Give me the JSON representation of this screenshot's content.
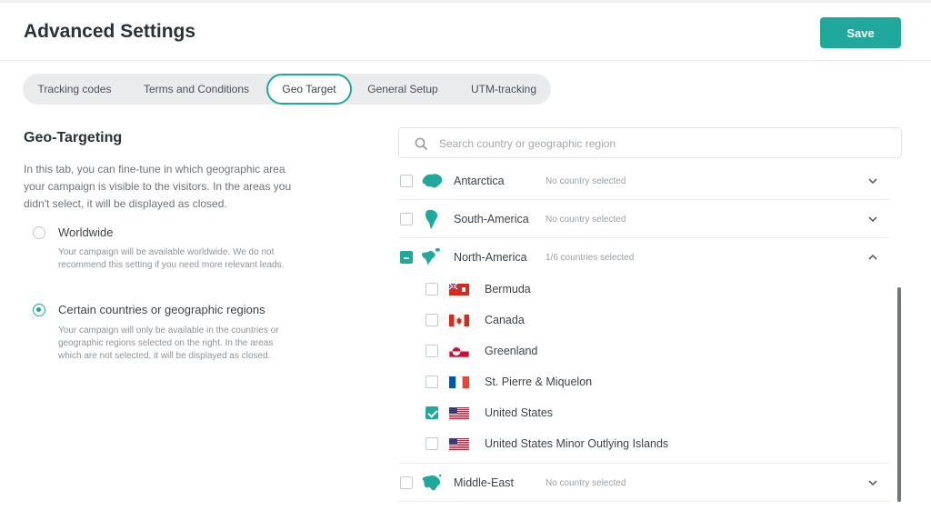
{
  "header": {
    "title": "Advanced Settings",
    "save_label": "Save"
  },
  "tabs": [
    {
      "label": "Tracking codes",
      "active": false
    },
    {
      "label": "Terms and Conditions",
      "active": false
    },
    {
      "label": "Geo Target",
      "active": true
    },
    {
      "label": "General Setup",
      "active": false
    },
    {
      "label": "UTM-tracking",
      "active": false
    }
  ],
  "geo": {
    "title": "Geo-Targeting",
    "description": "In this tab, you can fine-tune in which geographic area your campaign is visible to the visitors. In the areas you didn't select, it will be displayed as closed.",
    "options": [
      {
        "label": "Worldwide",
        "description": "Your campaign will be available worldwide. We do not recommend this setting if you need more relevant leads.",
        "selected": false
      },
      {
        "label": "Certain countries or geographic regions",
        "description": "Your campaign will only be available in the countries or geographic regions selected on the right. In the areas which are not selected, it will be displayed as closed.",
        "selected": true
      }
    ]
  },
  "search": {
    "placeholder": "Search country or geographic region",
    "value": ""
  },
  "regions": [
    {
      "name": "Antarctica",
      "status": "No country selected",
      "state": "unchecked",
      "expanded": false,
      "icon": "antarctica-map-icon"
    },
    {
      "name": "South-America",
      "status": "No country selected",
      "state": "unchecked",
      "expanded": false,
      "icon": "south-america-map-icon"
    },
    {
      "name": "North-America",
      "status": "1/6 countries selected",
      "state": "partial",
      "expanded": true,
      "icon": "north-america-map-icon"
    },
    {
      "name": "Middle-East",
      "status": "No country selected",
      "state": "unchecked",
      "expanded": false,
      "icon": "middle-east-map-icon"
    }
  ],
  "countries": [
    {
      "name": "Bermuda",
      "checked": false,
      "flag": "bermuda-flag-icon"
    },
    {
      "name": "Canada",
      "checked": false,
      "flag": "canada-flag-icon"
    },
    {
      "name": "Greenland",
      "checked": false,
      "flag": "greenland-flag-icon"
    },
    {
      "name": "St. Pierre & Miquelon",
      "checked": false,
      "flag": "st-pierre-miquelon-flag-icon"
    },
    {
      "name": "United States",
      "checked": true,
      "flag": "us-flag-icon"
    },
    {
      "name": "United States Minor Outlying Islands",
      "checked": false,
      "flag": "us-minor-islands-flag-icon"
    }
  ],
  "colors": {
    "accent": "#1fa89b",
    "text": "#3d4449",
    "muted": "#9aa1a6"
  }
}
